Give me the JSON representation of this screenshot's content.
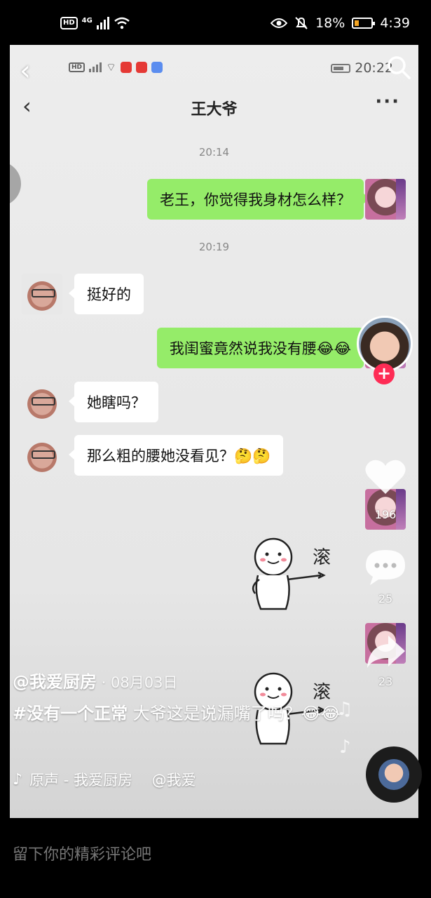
{
  "status_bar": {
    "hd": "HD",
    "network": "4G",
    "battery_percent": "18%",
    "time": "4:39",
    "battery_color": "#f5a623"
  },
  "screen_recording": {
    "status_time": "20:22",
    "app_icon_colors": [
      "#e53935",
      "#e53935",
      "#5b8def"
    ]
  },
  "chat": {
    "title": "王大爷",
    "messages": [
      {
        "type": "timestamp",
        "text": "20:14"
      },
      {
        "type": "sent",
        "text": "老王，你觉得我身材怎么样？"
      },
      {
        "type": "timestamp",
        "text": "20:19"
      },
      {
        "type": "received",
        "text": "挺好的"
      },
      {
        "type": "sent",
        "text": "我闺蜜竟然说我没有腰😂😂"
      },
      {
        "type": "received",
        "text": "她瞎吗？"
      },
      {
        "type": "received",
        "text": "那么粗的腰她没看见？🤔🤔"
      }
    ],
    "stickers": [
      {
        "text": "滚"
      },
      {
        "text": "滚"
      }
    ],
    "sent_bubble_color": "#95ec69"
  },
  "rail": {
    "like_count": "196",
    "comment_count": "25",
    "share_count": "23",
    "follow_symbol": "+",
    "follow_color": "#fe2c55"
  },
  "caption": {
    "author": "@我爱厨房",
    "date": " · 08月03日",
    "hashtag": "#没有一个正常",
    "text": " 大爷这是说漏嘴了吗？😂😂",
    "music": "原声 - 我爱厨房　 @我爱"
  },
  "comment": {
    "placeholder": "留下你的精彩评论吧"
  }
}
